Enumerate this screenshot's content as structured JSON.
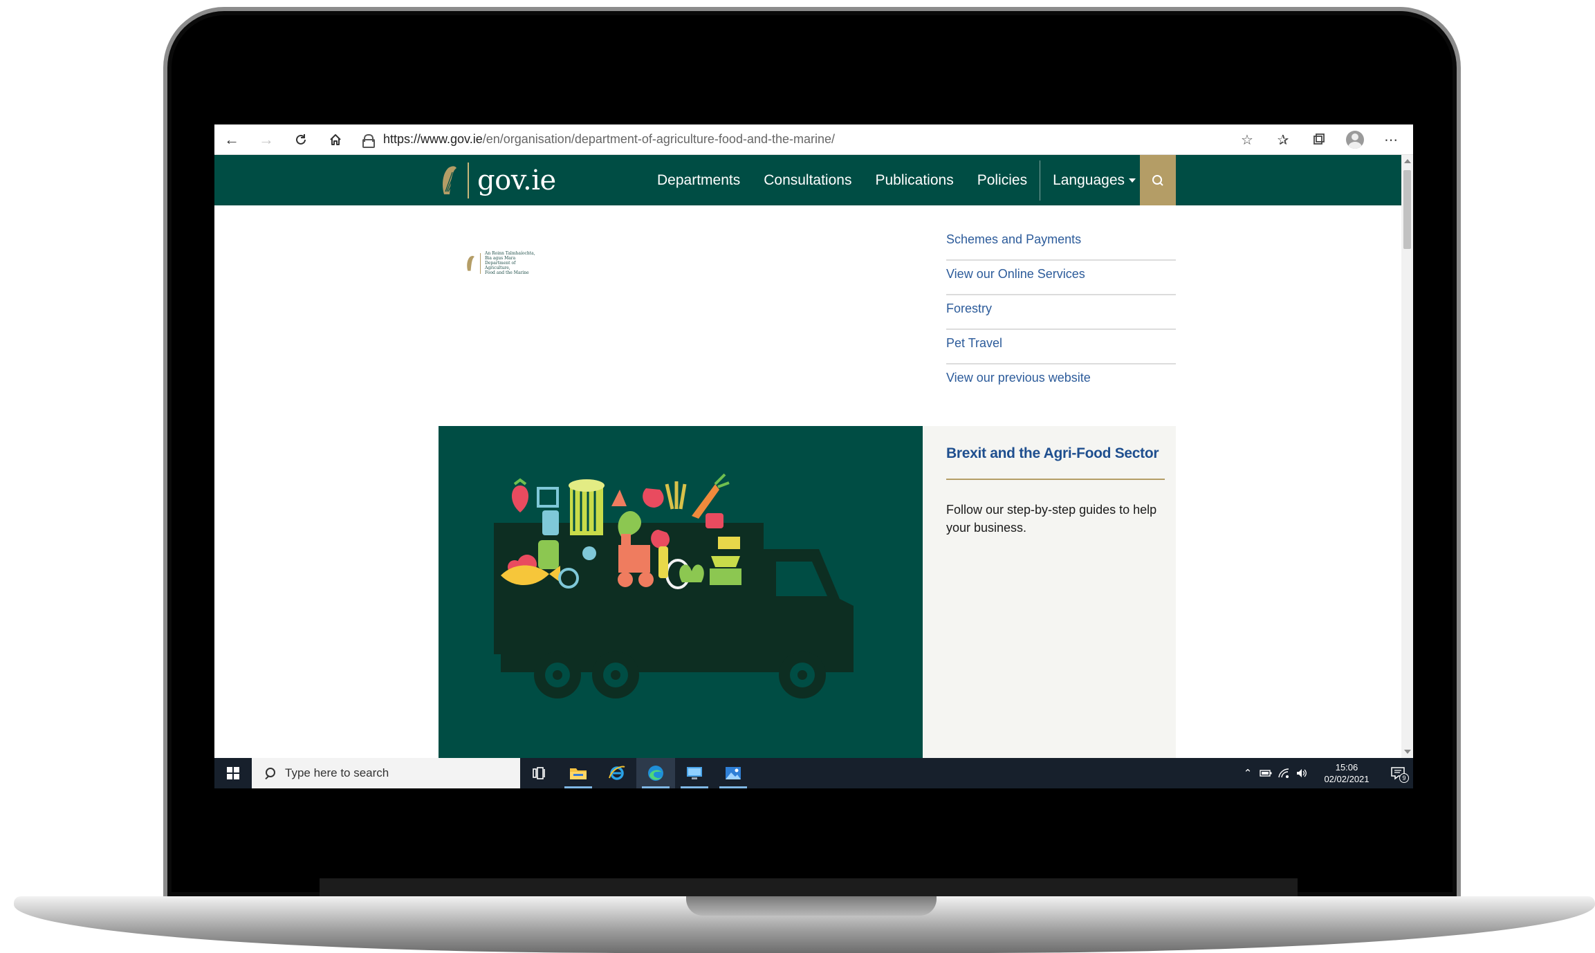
{
  "browser": {
    "url_host": "https://www.gov.ie",
    "url_path": "/en/organisation/department-of-agriculture-food-and-the-marine/"
  },
  "site": {
    "logo_text": "gov.ie",
    "nav": [
      {
        "label": "Departments"
      },
      {
        "label": "Consultations"
      },
      {
        "label": "Publications"
      },
      {
        "label": "Policies"
      },
      {
        "label": "Languages"
      }
    ],
    "brand_color": "#004d44",
    "accent_color": "#b49d66"
  },
  "dept_logo_lines": [
    "An Roinn Talmhaíochta,",
    "Bia agus Mara",
    "Department of Agriculture,",
    "Food and the Marine"
  ],
  "quick_links": [
    {
      "label": "Schemes and Payments"
    },
    {
      "label": "View our Online Services"
    },
    {
      "label": "Forestry"
    },
    {
      "label": "Pet Travel"
    },
    {
      "label": "View our previous website"
    }
  ],
  "feature": {
    "title": "Brexit and the Agri-Food Sector",
    "description": "Follow our step-by-step guides to help your business."
  },
  "taskbar": {
    "search_placeholder": "Type here to search",
    "time": "15:06",
    "date": "02/02/2021",
    "notification_count": "9"
  }
}
